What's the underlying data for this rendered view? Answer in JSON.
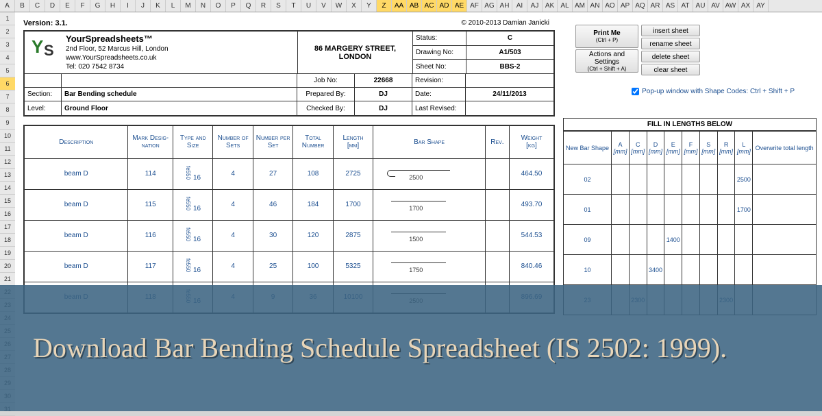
{
  "version": "Version: 3.1.",
  "copyright": "© 2010-2013 Damian Janicki",
  "company": {
    "name": "YourSpreadsheets™",
    "addr1": "2nd Floor, 52 Marcus Hill, London",
    "url": "www.YourSpreadsheets.co.uk",
    "tel": "Tel: 020 7542 8734"
  },
  "project_addr": "86 MARGERY STREET, LONDON",
  "meta": {
    "status_l": "Status:",
    "status": "C",
    "drawing_l": "Drawing No:",
    "drawing": "A1/503",
    "sheet_l": "Sheet No:",
    "sheet": "BBS-2",
    "job_l": "Job No:",
    "job": "22668",
    "rev_l": "Revision:",
    "rev": "",
    "prep_l": "Prepared By:",
    "prep": "DJ",
    "date_l": "Date:",
    "date": "24/11/2013",
    "chk_l": "Checked By:",
    "chk": "DJ",
    "lrev_l": "Last Revised:",
    "lrev": ""
  },
  "section_l": "Section:",
  "section": "Bar Bending schedule",
  "level_l": "Level:",
  "level": "Ground Floor",
  "buttons": {
    "print": "Print Me",
    "print_sub": "(Ctrl + P)",
    "actions": "Actions and Settings",
    "actions_sub": "(Ctrl + Shift + A)",
    "insert": "insert sheet",
    "rename": "rename sheet",
    "delete": "delete sheet",
    "clear": "clear sheet"
  },
  "popup": "Pop-up window with Shape Codes: Ctrl + Shift + P",
  "main_headers": [
    "Description",
    "Mark Desig-nation",
    "Type and Size",
    "Number of Sets",
    "Number per Set",
    "Total Number",
    "Length [mm]",
    "Bar Shape",
    "Rev.",
    "Weight [kg]"
  ],
  "rows": [
    {
      "desc": "beam D",
      "mark": "114",
      "type": "fe550",
      "size": "16",
      "sets": "4",
      "per": "27",
      "total": "108",
      "len": "2725",
      "dim": "2500",
      "rev": "",
      "wt": "464.50"
    },
    {
      "desc": "beam D",
      "mark": "115",
      "type": "fe550",
      "size": "16",
      "sets": "4",
      "per": "46",
      "total": "184",
      "len": "1700",
      "dim": "1700",
      "rev": "",
      "wt": "493.70"
    },
    {
      "desc": "beam D",
      "mark": "116",
      "type": "fe550",
      "size": "16",
      "sets": "4",
      "per": "30",
      "total": "120",
      "len": "2875",
      "dim": "1500",
      "rev": "",
      "wt": "544.53"
    },
    {
      "desc": "beam D",
      "mark": "117",
      "type": "fe550",
      "size": "16",
      "sets": "4",
      "per": "25",
      "total": "100",
      "len": "5325",
      "dim": "1750",
      "rev": "",
      "wt": "840.46"
    },
    {
      "desc": "beam D",
      "mark": "118",
      "type": "fe550",
      "size": "16",
      "sets": "4",
      "per": "9",
      "total": "36",
      "len": "10100",
      "dim": "2500",
      "rev": "",
      "wt": "896.69"
    }
  ],
  "side_title": "FILL IN LENGTHS BELOW",
  "side_headers": [
    "New Bar Shape",
    "A [mm]",
    "C [mm]",
    "D [mm]",
    "E [mm]",
    "F [mm]",
    "S [mm]",
    "R [mm]",
    "L [mm]",
    "Overwrite total length"
  ],
  "side_rows": [
    {
      "shape": "02",
      "A": "",
      "C": "",
      "D": "",
      "E": "",
      "F": "",
      "S": "",
      "R": "",
      "L": "2500",
      "ov": ""
    },
    {
      "shape": "01",
      "A": "",
      "C": "",
      "D": "",
      "E": "",
      "F": "",
      "S": "",
      "R": "",
      "L": "1700",
      "ov": ""
    },
    {
      "shape": "09",
      "A": "",
      "C": "",
      "D": "",
      "E": "1400",
      "F": "",
      "S": "",
      "R": "",
      "L": "",
      "ov": ""
    },
    {
      "shape": "10",
      "A": "",
      "C": "",
      "D": "3400",
      "E": "",
      "F": "",
      "S": "",
      "R": "",
      "L": "",
      "ov": ""
    },
    {
      "shape": "23",
      "A": "",
      "C": "2300",
      "D": "",
      "E": "",
      "F": "",
      "S": "",
      "R": "2300",
      "L": "",
      "ov": ""
    }
  ],
  "overlay": "Download Bar Bending Schedule Spreadsheet (IS 2502: 1999).",
  "cols": [
    "A",
    "B",
    "C",
    "D",
    "E",
    "F",
    "G",
    "H",
    "I",
    "J",
    "K",
    "L",
    "M",
    "N",
    "O",
    "P",
    "Q",
    "R",
    "S",
    "T",
    "U",
    "V",
    "W",
    "X",
    "Y",
    "Z",
    "AA",
    "AB",
    "AC",
    "AD",
    "AE",
    "AF",
    "AG",
    "AH",
    "AI",
    "AJ",
    "AK",
    "AL",
    "AM",
    "AN",
    "AO",
    "AP",
    "AQ",
    "AR",
    "AS",
    "AT",
    "AU",
    "AV",
    "AW",
    "AX",
    "AY"
  ]
}
